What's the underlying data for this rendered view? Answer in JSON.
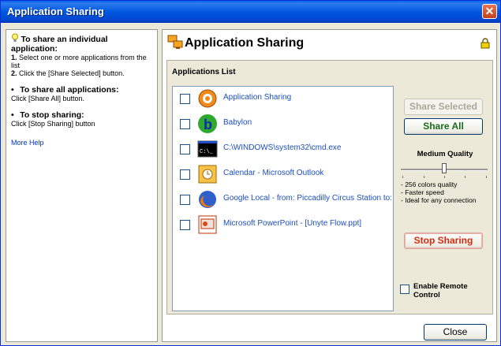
{
  "window": {
    "title": "Application Sharing",
    "close_glyph": "✕"
  },
  "help": {
    "individual_heading": "To share an individual application:",
    "individual_step1_num": "1.",
    "individual_step1": " Select one or more applications from the list",
    "individual_step2_num": "2.",
    "individual_step2": " Click the [Share Selected] button.",
    "all_heading": "To share all applications:",
    "all_text": "Click [Share All] button.",
    "stop_heading": "To stop sharing:",
    "stop_text": "Click [Stop Sharing] button",
    "more_help": "More Help",
    "bullet": "•"
  },
  "main": {
    "title": "Application Sharing",
    "list_heading": "Applications List",
    "applications": [
      {
        "label": "Application Sharing",
        "icon": "app-sharing-icon",
        "checked": false
      },
      {
        "label": "Babylon",
        "icon": "babylon-icon",
        "checked": false
      },
      {
        "label": "C:\\WINDOWS\\system32\\cmd.exe",
        "icon": "cmd-icon",
        "checked": false
      },
      {
        "label": "Calendar - Microsoft Outlook",
        "icon": "outlook-calendar-icon",
        "checked": false
      },
      {
        "label": "Google Local - from: Piccadilly Circus Station to: T",
        "icon": "firefox-icon",
        "checked": false
      },
      {
        "label": "Microsoft PowerPoint - [Unyte Flow.ppt]",
        "icon": "powerpoint-icon",
        "checked": false
      }
    ],
    "share_selected": "Share Selected",
    "share_all": "Share All",
    "quality_label": "Medium Quality",
    "quality_desc": [
      "- 256 colors quality",
      "- Faster speed",
      "- Ideal for any connection"
    ],
    "stop_sharing": "Stop Sharing",
    "remote_control": "Enable Remote Control",
    "close": "Close"
  },
  "colors": {
    "title_bar": "#0058E0",
    "link": "#1C4FBF",
    "share_all": "#1A6B1A",
    "stop": "#D92B0E"
  }
}
